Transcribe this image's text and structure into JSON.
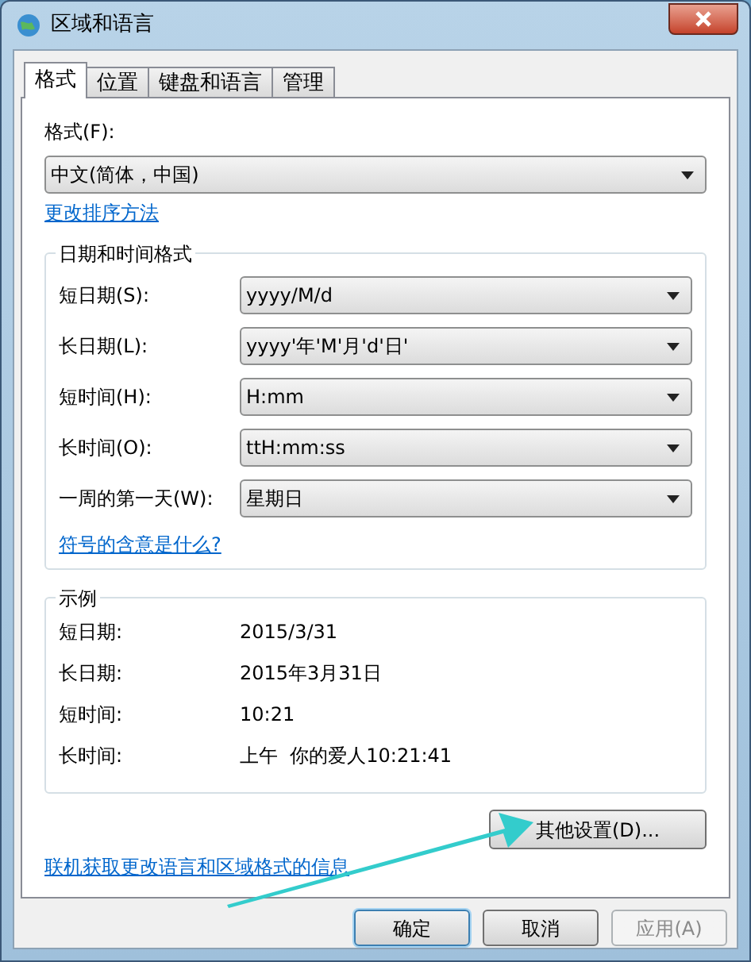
{
  "window": {
    "title": "区域和语言"
  },
  "tabs": [
    {
      "label": "格式",
      "selected": true
    },
    {
      "label": "位置",
      "selected": false
    },
    {
      "label": "键盘和语言",
      "selected": false
    },
    {
      "label": "管理",
      "selected": false
    }
  ],
  "format": {
    "label": "格式(F):",
    "value": "中文(简体，中国)",
    "link": "更改排序方法"
  },
  "date_time_group": {
    "title": "日期和时间格式",
    "rows": [
      {
        "label": "短日期(S):",
        "value": "yyyy/M/d"
      },
      {
        "label": "长日期(L):",
        "value": "yyyy'年'M'月'd'日'"
      },
      {
        "label": "短时间(H):",
        "value": "H:mm"
      },
      {
        "label": "长时间(O):",
        "value": "ttH:mm:ss"
      },
      {
        "label": "一周的第一天(W):",
        "value": "星期日"
      }
    ],
    "link": "符号的含意是什么?"
  },
  "example_group": {
    "title": "示例",
    "rows": [
      {
        "label": "短日期:",
        "value": "2015/3/31"
      },
      {
        "label": "长日期:",
        "value": "2015年3月31日"
      },
      {
        "label": "短时间:",
        "value": "10:21"
      },
      {
        "label": "长时间:",
        "value": "上午  你的爱人10:21:41"
      }
    ]
  },
  "more_settings_button": "其他设置(D)...",
  "online_link": "联机获取更改语言和区域格式的信息",
  "buttons": [
    {
      "label": "确定",
      "default": true,
      "disabled": false
    },
    {
      "label": "取消",
      "default": false,
      "disabled": false
    },
    {
      "label": "应用(A)",
      "default": false,
      "disabled": true
    }
  ]
}
